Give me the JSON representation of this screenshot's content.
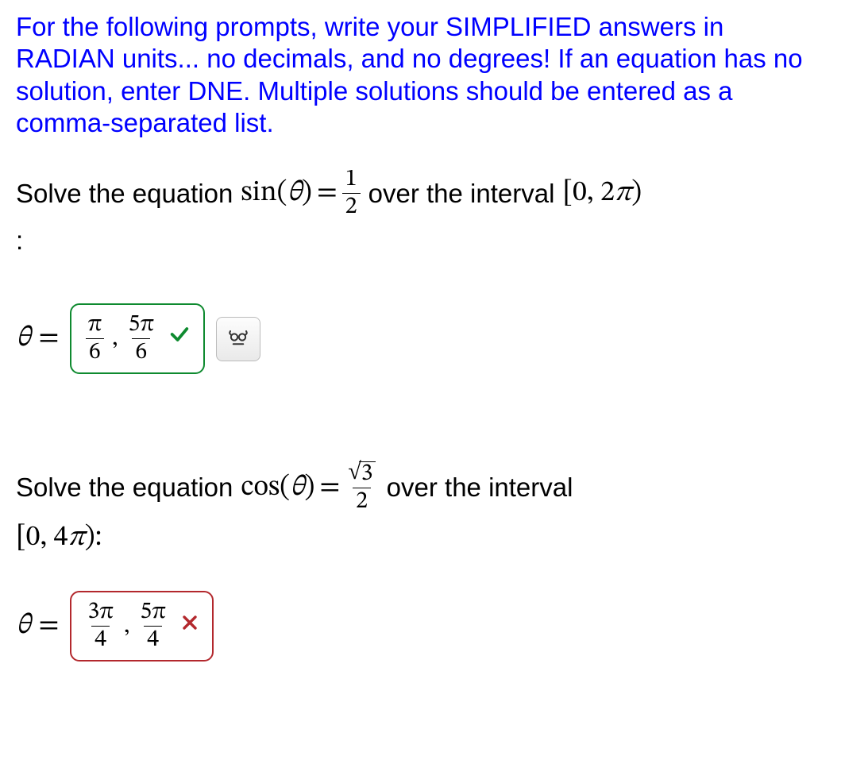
{
  "instructions": "For the following prompts, write your SIMPLIFIED answers in RADIAN units... no decimals, and no degrees! If an equation has no solution, enter DNE. Multiple solutions should be entered as a comma-separated list.",
  "q1": {
    "prompt_prefix": "Solve the equation",
    "equation_lhs": "sin(θ)",
    "equation_eq": "=",
    "rhs_num": "1",
    "rhs_den": "2",
    "prompt_mid": "over the interval",
    "interval": "[0, 2π)",
    "colon": ":",
    "theta_label": "θ",
    "eq_sign": "=",
    "answer": {
      "t1_num": "π",
      "t1_den": "6",
      "t2_num": "5π",
      "t2_den": "6"
    },
    "status": "correct",
    "mark": "✓"
  },
  "q2": {
    "prompt_prefix": "Solve the equation",
    "equation_lhs": "cos(θ)",
    "equation_eq": "=",
    "rhs_sqrt_radicand": "3",
    "rhs_den": "2",
    "prompt_mid": "over the interval",
    "interval": "[0, 4π):",
    "theta_label": "θ",
    "eq_sign": "=",
    "answer": {
      "t1_num": "3π",
      "t1_den": "4",
      "t2_num": "5π",
      "t2_den": "4"
    },
    "status": "incorrect",
    "mark": "✕"
  },
  "icons": {
    "preview": "preview-icon",
    "check": "check-icon",
    "cross": "cross-icon"
  },
  "comma": ","
}
